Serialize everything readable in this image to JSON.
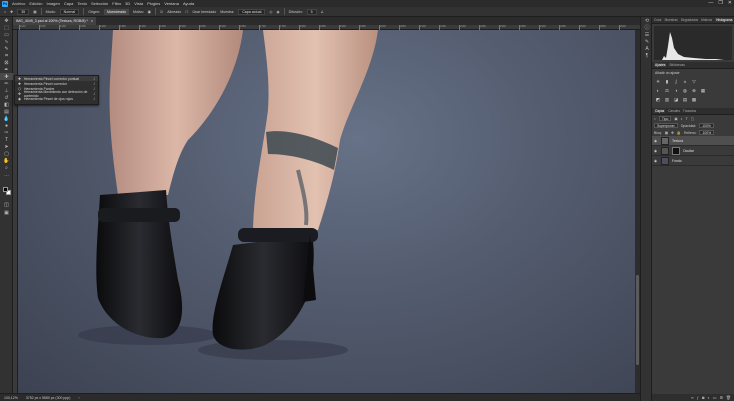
{
  "menubar": {
    "logo": "Ps",
    "items": [
      "Archivo",
      "Edición",
      "Imagen",
      "Capa",
      "Texto",
      "Selección",
      "Filtro",
      "3D",
      "Vista",
      "Plugins",
      "Ventana",
      "Ayuda"
    ],
    "window_controls": [
      "—",
      "❐",
      "✕"
    ]
  },
  "options_bar": {
    "brush_size": "35",
    "mode_label": "Modo:",
    "mode_value": "Normal",
    "origin_label": "Origen:",
    "origin_sampled": "Muestreado",
    "origin_pattern": "Motivo",
    "aligned": "Alineado",
    "use_legacy": "Usar heredado",
    "sample_label": "Muestra:",
    "sample_value": "Capa actual",
    "spread_label": "Difusión:",
    "spread_value": "5"
  },
  "document_tab": {
    "title": "IMG_4049_3.psd al 100% (Textura, RGB/8) *",
    "close": "×"
  },
  "ruler_labels": [
    "1100",
    "1150",
    "1200",
    "1250",
    "1300",
    "1350",
    "1400",
    "1450",
    "1500",
    "1550",
    "1600",
    "1650",
    "1700",
    "1750",
    "1800",
    "1850",
    "1900",
    "1950",
    "2000",
    "2050",
    "2100",
    "2150",
    "2200",
    "2250",
    "2300",
    "2350",
    "2400",
    "2450",
    "2500",
    "2550",
    "2600"
  ],
  "flyout": {
    "items": [
      {
        "label": "Herramienta Pincel corrector puntual",
        "key": "J"
      },
      {
        "label": "Herramienta Pincel corrector",
        "key": "J"
      },
      {
        "label": "Herramienta Parche",
        "key": "J"
      },
      {
        "label": "Herramienta Movimiento con detección de contenido",
        "key": "J"
      },
      {
        "label": "Herramienta Pincel de ojos rojos",
        "key": "J"
      }
    ]
  },
  "status_bar": {
    "zoom": "100,12%",
    "doc_info": "3752 px x 5580 px (300 ppp)",
    "arrow": "›"
  },
  "panels": {
    "top_tabs": [
      "Color",
      "Muestras",
      "Degradados",
      "Motivos",
      "Histograma"
    ],
    "adjust_tabs": [
      "Ajustes",
      "Bibliotecas"
    ],
    "adjust_subtitle": "Añadir un ajuste",
    "layers_tabs": [
      "Capas",
      "Canales",
      "Trazados"
    ],
    "kind_label": "Tipo",
    "blend_mode": "Superponer",
    "opacity_label": "Opacidad:",
    "opacity_value": "100%",
    "lock_label": "Bloq:",
    "fill_label": "Relleno:",
    "fill_value": "100%",
    "layers": [
      {
        "name": "Textura",
        "selected": true
      },
      {
        "name": "Ocultar",
        "selected": false
      },
      {
        "name": "Fondo",
        "selected": false
      }
    ]
  },
  "colors": {
    "accent": "#31a8ff",
    "canvas_bg": "#566073",
    "panel_bg": "#3a3a3a"
  }
}
